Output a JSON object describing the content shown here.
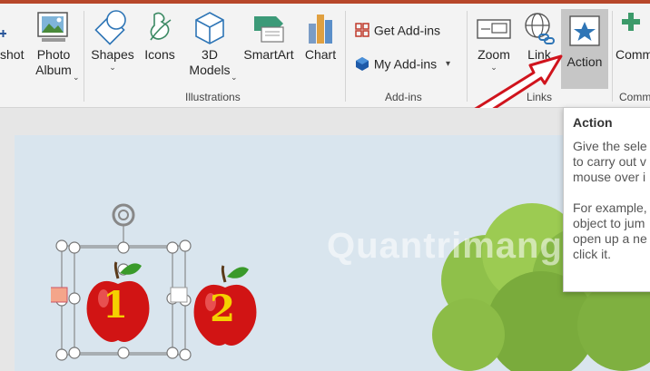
{
  "ribbon": {
    "screenshot_label": "shot",
    "photo_album_label": "Photo\nAlbum",
    "shapes_label": "Shapes",
    "icons_label": "Icons",
    "models3d_label": "3D\nModels",
    "smartart_label": "SmartArt",
    "chart_label": "Chart",
    "get_addins_label": "Get Add-ins",
    "my_addins_label": "My Add-ins",
    "zoom_label": "Zoom",
    "link_label": "Link",
    "action_label": "Action",
    "comment_label": "Comm",
    "groups": {
      "illustrations": "Illustrations",
      "addins": "Add-ins",
      "links": "Links",
      "comments": "Comm"
    }
  },
  "tooltip": {
    "title": "Action",
    "description": "Give the sele\nto carry out v\nmouse over i\n\nFor example,\nobject to jum\nopen up a ne\nclick it."
  },
  "slide": {
    "apple_left_number": "1",
    "apple_right_number": "2",
    "watermark": "Quantrimang"
  },
  "colors": {
    "accent": "#b7472a",
    "apple": "#d11414",
    "number": "#f5d000",
    "arrow": "#d0141d"
  }
}
